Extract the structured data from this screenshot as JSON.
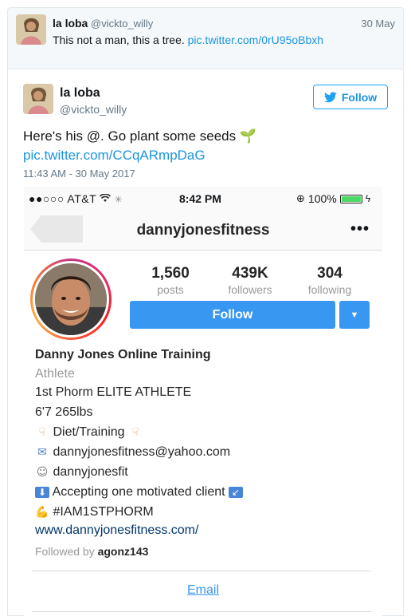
{
  "quoted_tweet": {
    "name": "la loba",
    "handle": "@vickto_willy",
    "date": "30 May",
    "text": "This not a man, this a tree.",
    "link": "pic.twitter.com/0rU95oBbxh"
  },
  "tweet": {
    "name": "la loba",
    "handle": "@vickto_willy",
    "follow_label": "Follow",
    "text": "Here's his @. Go plant some seeds",
    "text_emoji": "🌱",
    "link": "pic.twitter.com/CCqARmpDaG",
    "timestamp": "11:43 AM - 30 May 2017"
  },
  "phone": {
    "status": {
      "signal_carrier": "●●○○○ AT&T",
      "time": "8:42 PM",
      "battery": "100%"
    },
    "nav": {
      "title": "dannyjonesfitness",
      "more": "•••"
    },
    "stats": [
      {
        "value": "1,560",
        "label": "posts"
      },
      {
        "value": "439K",
        "label": "followers"
      },
      {
        "value": "304",
        "label": "following"
      }
    ],
    "follow_label": "Follow",
    "bio": {
      "name": "Danny Jones Online Training",
      "category": "Athlete",
      "line1": "1st Phorm ELITE ATHLETE",
      "line2": "6'7 265lbs",
      "line3": "Diet/Training",
      "line4": "dannyjonesfitness@yahoo.com",
      "line5": "dannyjonesfit",
      "line6": "Accepting one motivated client",
      "line7": "#IAM1STPHORM",
      "url": "www.dannyjonesfitness.com/",
      "followed_by_prefix": "Followed by",
      "followed_by_user": "agonz143"
    },
    "email_label": "Email"
  },
  "colors": {
    "twitter_blue": "#1da1f2",
    "instagram_blue": "#3897f0"
  }
}
